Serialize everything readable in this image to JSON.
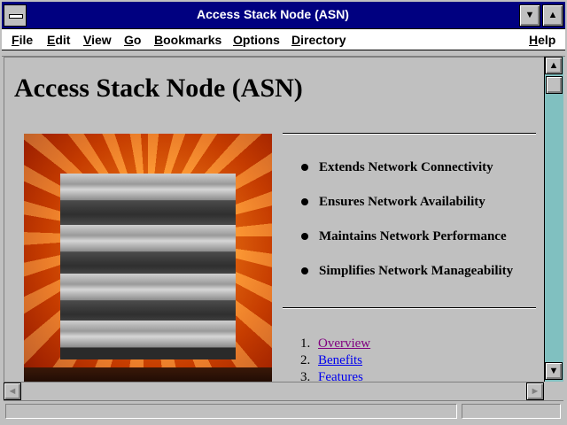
{
  "window": {
    "title": "Access Stack Node (ASN)",
    "minimize_glyph": "▼",
    "maximize_glyph": "▲"
  },
  "menubar": {
    "items": [
      {
        "mnemonic": "F",
        "rest": "ile"
      },
      {
        "mnemonic": "E",
        "rest": "dit"
      },
      {
        "mnemonic": "V",
        "rest": "iew"
      },
      {
        "mnemonic": "G",
        "rest": "o"
      },
      {
        "mnemonic": "B",
        "rest": "ookmarks"
      },
      {
        "mnemonic": "O",
        "rest": "ptions"
      },
      {
        "mnemonic": "D",
        "rest": "irectory"
      },
      {
        "mnemonic": "H",
        "rest": "elp"
      }
    ]
  },
  "content": {
    "heading": "Access Stack Node (ASN)",
    "bullets": [
      "Extends Network Connectivity",
      "Ensures Network Availability",
      "Maintains Network Performance",
      "Simplifies Network Manageability"
    ],
    "links": [
      {
        "number": "1.",
        "label": "Overview",
        "state": "visited"
      },
      {
        "number": "2.",
        "label": "Benefits",
        "state": "unvisited"
      },
      {
        "number": "3.",
        "label": "Features",
        "state": "unvisited"
      }
    ]
  },
  "scrollbars": {
    "up_glyph": "▲",
    "down_glyph": "▼",
    "left_glyph": "◄",
    "right_glyph": "►"
  },
  "status": {
    "message": ""
  },
  "colors": {
    "title_bar": "#000080",
    "link_visited": "#800080",
    "link_unvisited": "#0000ee",
    "scroll_track": "#80c0c0"
  },
  "icons": {
    "bullet": "filled-circle"
  }
}
